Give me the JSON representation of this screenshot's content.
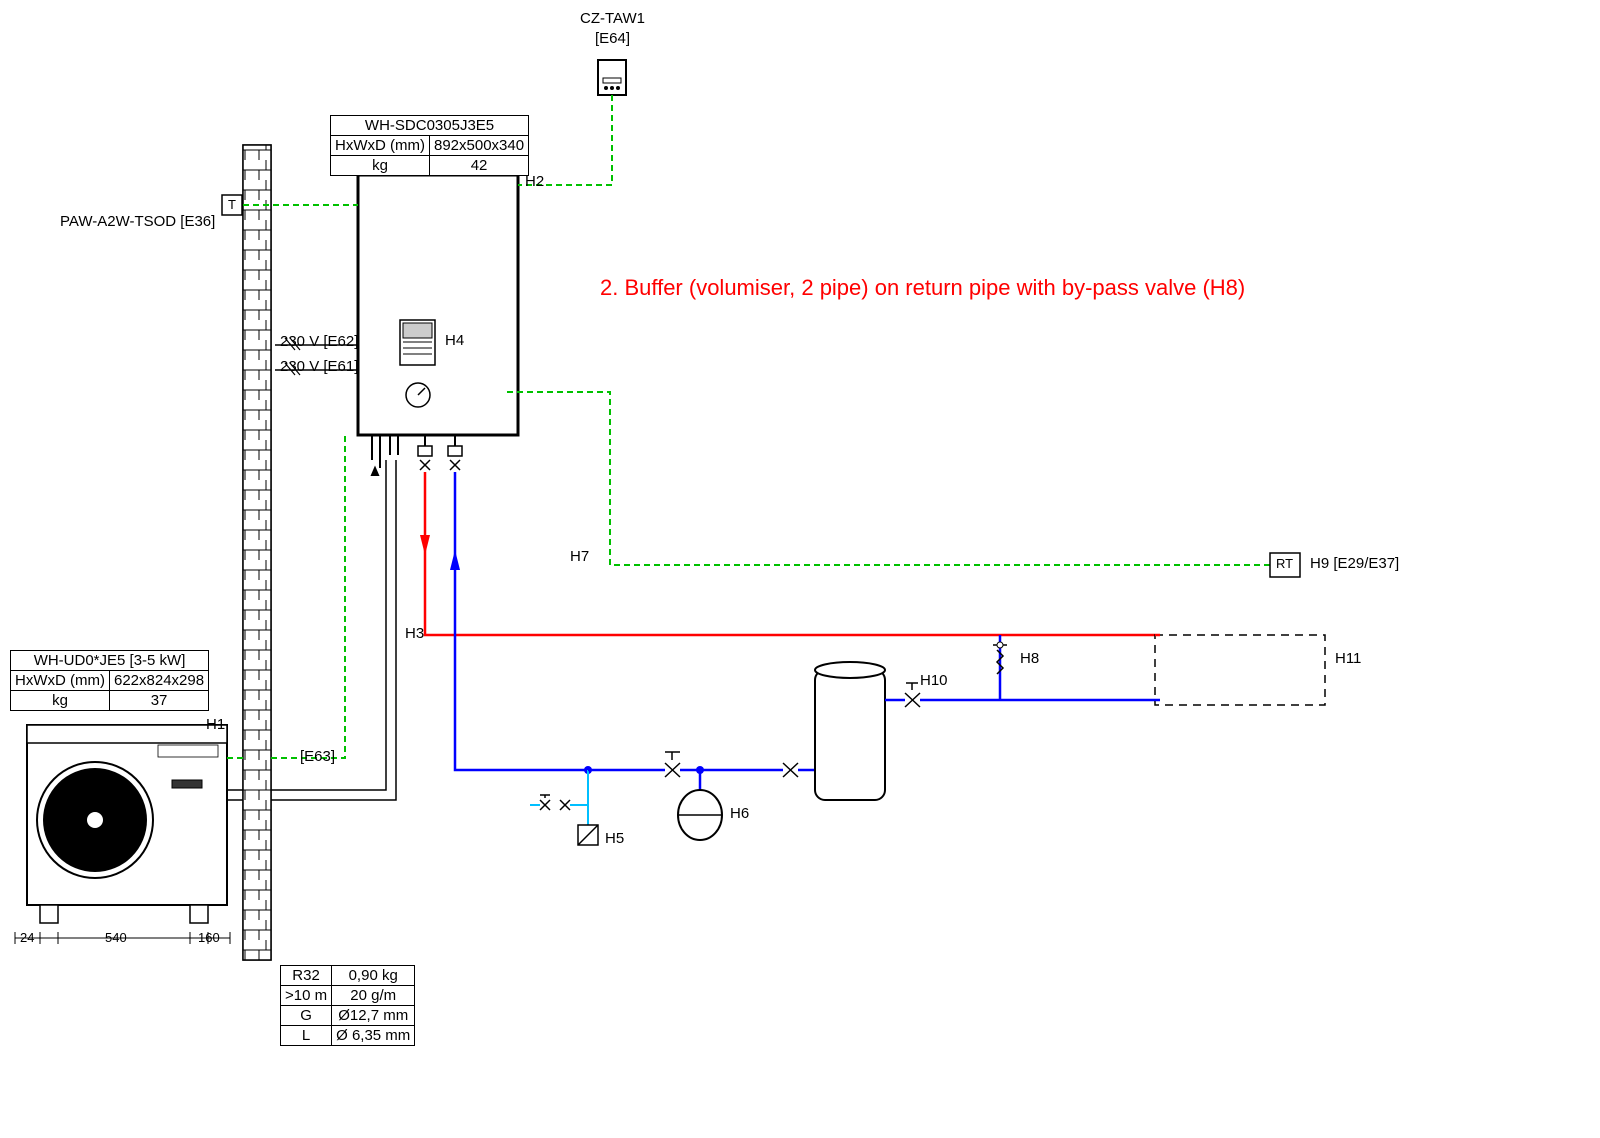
{
  "title_annotation": "2. Buffer (volumiser, 2 pipe)  on return pipe with by-pass valve (H8)",
  "cloud_adapter": {
    "model": "CZ-TAW1",
    "code": "[E64]"
  },
  "indoor_unit": {
    "model": "WH-SDC0305J3E5",
    "dim_label": "HxWxD (mm)",
    "dim_value": "892x500x340",
    "weight_label": "kg",
    "weight_value": "42"
  },
  "outdoor_unit": {
    "model": "WH-UD0*JE5 [3-5 kW]",
    "dim_label": "HxWxD (mm)",
    "dim_value": "622x824x298",
    "weight_label": "kg",
    "weight_value": "37"
  },
  "outdoor_sensor": "PAW-A2W-TSOD [E36]",
  "power": {
    "e62": "230 V [E62]",
    "e61": "230 V [E61]",
    "e63": "[E63]"
  },
  "refrigerant_table": {
    "r1c1": "R32",
    "r1c2": "0,90 kg",
    "r2c1": ">10 m",
    "r2c2": "20 g/m",
    "r3c1": "G",
    "r3c2": "Ø12,7 mm",
    "r4c1": "L",
    "r4c2": "Ø 6,35 mm"
  },
  "outdoor_dims": {
    "d1": "24",
    "d2": "540",
    "d3": "160"
  },
  "labels": {
    "h1": "H1",
    "h2": "H2",
    "h3": "H3",
    "h4": "H4",
    "h5": "H5",
    "h6": "H6",
    "h7": "H7",
    "h8": "H8",
    "h9": "H9 [E29/E37]",
    "h10": "H10",
    "h11": "H11",
    "rt": "RT",
    "t": "T"
  }
}
